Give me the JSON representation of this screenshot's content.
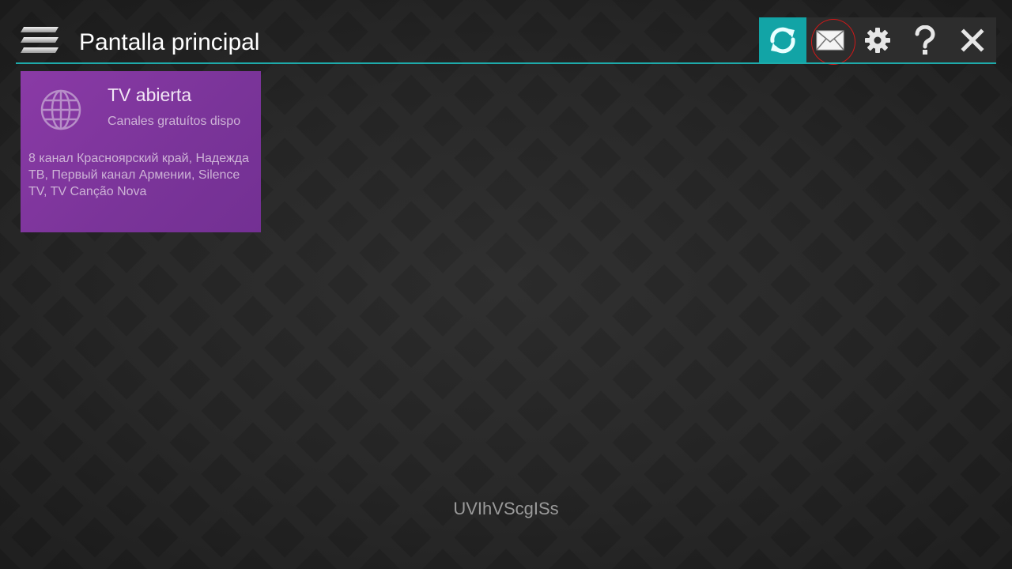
{
  "header": {
    "title": "Pantalla principal",
    "accent_color": "#1eaaaa"
  },
  "toolbar": {
    "buttons": [
      {
        "name": "refresh-button",
        "icon": "refresh-icon",
        "active": true
      },
      {
        "name": "messages-button",
        "icon": "envelope-icon",
        "active": false
      },
      {
        "name": "settings-button",
        "icon": "gear-icon",
        "active": false,
        "focused": true
      },
      {
        "name": "help-button",
        "icon": "question-icon",
        "active": false
      },
      {
        "name": "close-button",
        "icon": "close-icon",
        "active": false
      }
    ],
    "active_color": "#12a4a6",
    "focus_color": "#d01818"
  },
  "tiles": [
    {
      "icon": "globe-icon",
      "title": "TV abierta",
      "subtitle": "Canales gratuítos dispo",
      "description": "8 канал Красноярский край, Надежда ТВ, Первый канал Армении, Silence TV, TV Canção Nova",
      "color": "#7f37a0"
    }
  ],
  "footer": {
    "code": "UVIhVScgISs"
  }
}
